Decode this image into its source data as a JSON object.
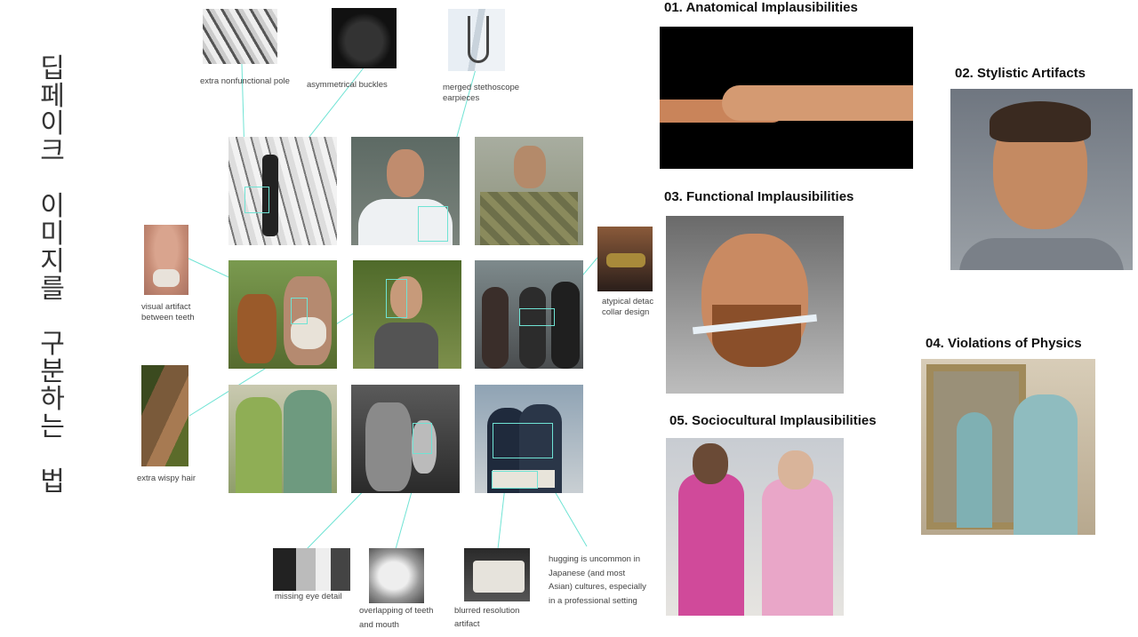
{
  "vertical_title": [
    "딥",
    "페",
    "이",
    "크",
    "",
    "이",
    "미",
    "지",
    "를",
    "",
    "구",
    "분",
    "하",
    "는",
    "",
    "법"
  ],
  "sections": {
    "s1": "01. Anatomical Implausibilities",
    "s2": "02. Stylistic Artifacts",
    "s3": "03. Functional Implausibilities",
    "s4": "04. Violations of Physics",
    "s5": "05. Sociocultural Implausibilities"
  },
  "captions": {
    "pole": "extra nonfunctional pole",
    "buckles": "asymmetrical buckles",
    "stethoscope": "merged stethoscope earpieces",
    "teeth_gap": "visual artifact between teeth",
    "collar": "atypical detac collar design",
    "hair": "extra wispy hair",
    "eye": "missing eye detail",
    "overlap": "overlapping of teeth and mouth",
    "blur": "blurred resolution artifact",
    "hugging": "hugging is uncommon in Japanese (and most Asian) cultures, especially in a professional setting"
  },
  "colors": {
    "accent": "#6fe3d4"
  }
}
